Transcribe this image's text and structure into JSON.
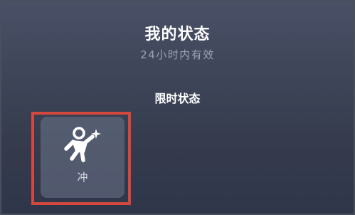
{
  "header": {
    "title": "我的状态",
    "subtitle": "24小时内有效"
  },
  "section": {
    "label": "限时状态"
  },
  "status_items": [
    {
      "label": "冲",
      "icon": "running-person-sparkle-icon",
      "highlighted": true
    }
  ],
  "colors": {
    "highlight_border": "#d3473d",
    "title_text": "#ffffff",
    "subtitle_text": "#9aa1b6",
    "background_top": "#4a5066",
    "background_bottom": "#30364a"
  }
}
